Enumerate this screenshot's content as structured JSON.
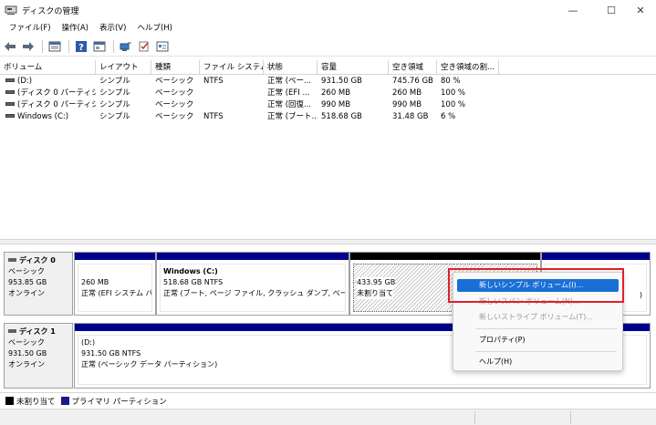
{
  "window": {
    "title": "ディスクの管理",
    "controls": [
      "—",
      "☐",
      "✕"
    ]
  },
  "menu": [
    "ファイル(F)",
    "操作(A)",
    "表示(V)",
    "ヘルプ(H)"
  ],
  "toolbar": {
    "icons": [
      "back-arrow-icon",
      "forward-arrow-icon",
      "view-icon",
      "help-icon",
      "properties-icon",
      "connect-icon",
      "check-icon",
      "settings-icon"
    ]
  },
  "volume_list": {
    "columns": [
      "ボリューム",
      "レイアウト",
      "種類",
      "ファイル システム",
      "状態",
      "容量",
      "空き領域",
      "空き領域の割..."
    ],
    "rows": [
      [
        "(D:)",
        "シンプル",
        "ベーシック",
        "NTFS",
        "正常 (ベー...",
        "931.50 GB",
        "745.76 GB",
        "80 %"
      ],
      [
        "(ディスク 0 パーティシ...",
        "シンプル",
        "ベーシック",
        "",
        "正常 (EFI ...",
        "260 MB",
        "260 MB",
        "100 %"
      ],
      [
        "(ディスク 0 パーティシ...",
        "シンプル",
        "ベーシック",
        "",
        "正常 (回復...",
        "990 MB",
        "990 MB",
        "100 %"
      ],
      [
        "Windows (C:)",
        "シンプル",
        "ベーシック",
        "NTFS",
        "正常 (ブート...",
        "518.68 GB",
        "31.48 GB",
        "6 %"
      ]
    ]
  },
  "disks": [
    {
      "name": "ディスク 0",
      "type": "ベーシック",
      "size": "953.85 GB",
      "status": "オンライン",
      "partitions": [
        {
          "line1": "",
          "line2": "260 MB",
          "line3": "正常 (EFI システム パ"
        },
        {
          "line1": "Windows  (C:)",
          "line2": "518.68 GB NTFS",
          "line3": "正常 (ブート, ページ ファイル, クラッシュ ダンプ, ベーシック デ"
        },
        {
          "line1": "",
          "line2": "433.95 GB",
          "line3": "未割り当て"
        },
        {
          "line1": "",
          "line2": "",
          "line3": ""
        }
      ]
    },
    {
      "name": "ディスク 1",
      "type": "ベーシック",
      "size": "931.50 GB",
      "status": "オンライン",
      "partitions": [
        {
          "line1": "(D:)",
          "line2": "931.50 GB NTFS",
          "line3": "正常 (ベーシック データ パーティション)"
        }
      ]
    }
  ],
  "disk0_trailing_fragment": ")",
  "legend": [
    {
      "label": "未割り当て",
      "color": "#000000"
    },
    {
      "label": "プライマリ パーティション",
      "color": "#1a1a8c"
    }
  ],
  "context_menu": {
    "items": [
      {
        "label": "新しいシンプル ボリューム(I)...",
        "state": "highlighted"
      },
      {
        "label": "新しいスパン ボリューム(N)...",
        "state": "disabled"
      },
      {
        "label": "新しいストライプ ボリューム(T)...",
        "state": "disabled"
      },
      {
        "label": "プロパティ(P)",
        "state": "enabled"
      },
      {
        "label": "ヘルプ(H)",
        "state": "enabled"
      }
    ]
  },
  "colors": {
    "primary_partition_bar": "#00008b",
    "unallocated_bar": "#000000",
    "highlight": "#1a6fd6",
    "annotation_box": "#e0202a"
  }
}
